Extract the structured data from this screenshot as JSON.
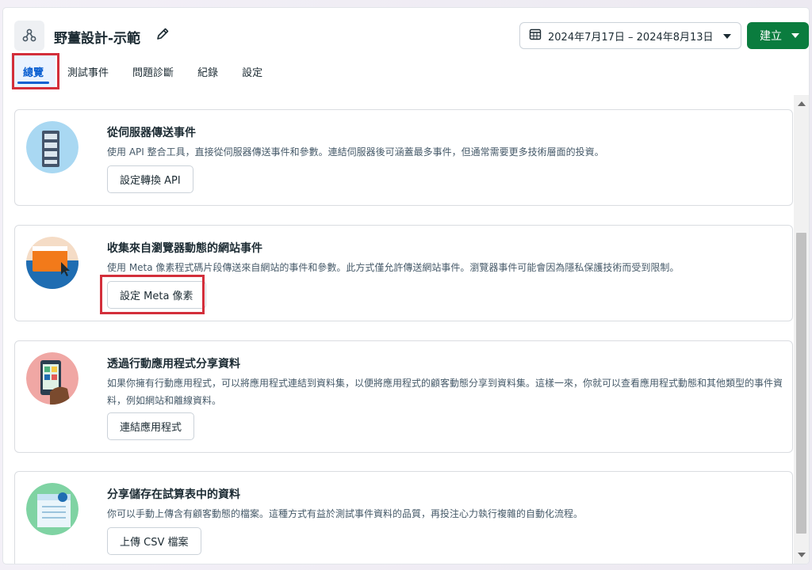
{
  "header": {
    "title": "野薑設計-示範",
    "date_range": "2024年7月17日 – 2024年8月13日",
    "create_label": "建立"
  },
  "tabs": [
    {
      "label": "總覽",
      "active": true
    },
    {
      "label": "測試事件",
      "active": false
    },
    {
      "label": "問題診斷",
      "active": false
    },
    {
      "label": "紀錄",
      "active": false
    },
    {
      "label": "設定",
      "active": false
    }
  ],
  "cards": [
    {
      "title": "從伺服器傳送事件",
      "description": "使用 API 整合工具，直接從伺服器傳送事件和參數。連結伺服器後可涵蓋最多事件，但通常需要更多技術層面的投資。",
      "button": "設定轉換 API"
    },
    {
      "title": "收集來自瀏覽器動態的網站事件",
      "description": "使用 Meta 像素程式碼片段傳送來自網站的事件和參數。此方式僅允許傳送網站事件。瀏覽器事件可能會因為隱私保護技術而受到限制。",
      "button": "設定 Meta 像素"
    },
    {
      "title": "透過行動應用程式分享資料",
      "description": "如果你擁有行動應用程式，可以將應用程式連結到資料集，以便將應用程式的顧客動態分享到資料集。這樣一來，你就可以查看應用程式動態和其他類型的事件資料，例如網站和離線資料。",
      "button": "連結應用程式"
    },
    {
      "title": "分享儲存在試算表中的資料",
      "description": "你可以手動上傳含有顧客動態的檔案。這種方式有益於測試事件資料的品質，再投注心力執行複雜的自動化流程。",
      "button": "上傳 CSV 檔案"
    }
  ],
  "colors": {
    "primary_green": "#0a7c3e",
    "active_tab_blue": "#0a5fd1",
    "highlight_red": "#d32f3b"
  },
  "icons": [
    "dataset-icon",
    "pencil-icon",
    "calendar-icon",
    "caret-down-icon"
  ]
}
